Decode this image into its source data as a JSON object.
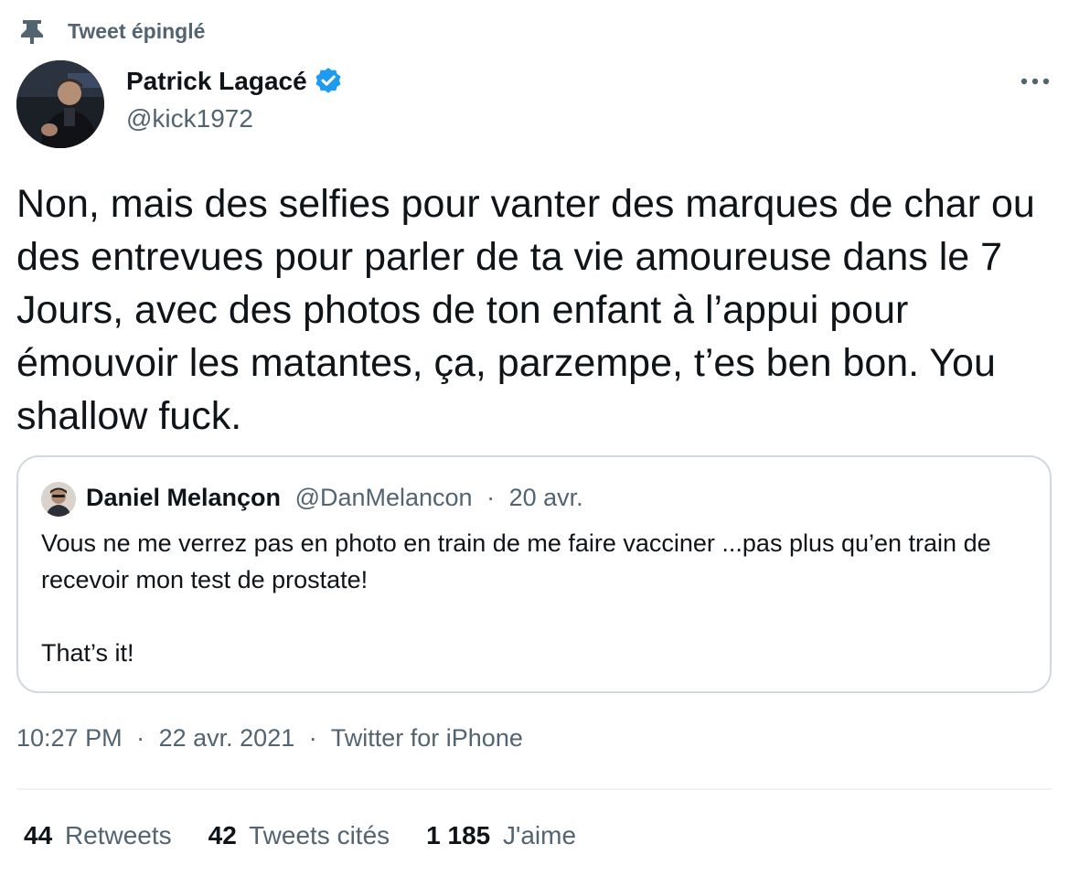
{
  "pinned": {
    "label": "Tweet épinglé",
    "icon": "pin-icon"
  },
  "author": {
    "name": "Patrick Lagacé",
    "handle": "@kick1972",
    "verified": true,
    "verified_color": "#1d9bf0"
  },
  "tweet": {
    "text": "Non, mais des selfies pour vanter des marques de char ou des entrevues pour parler de ta vie amoureuse dans le 7 Jours, avec des photos de ton enfant à l’appui pour émouvoir les matantes, ça, parzempe, t’es ben bon. You shallow fuck."
  },
  "quote": {
    "name": "Daniel Melançon",
    "handle": "@DanMelancon",
    "separator": "·",
    "date": "20 avr.",
    "paragraph1": "Vous ne me verrez pas en photo en train de me faire vacciner ...pas plus qu’en train de recevoir mon test de prostate!",
    "paragraph2": "That’s it!"
  },
  "meta": {
    "time": "10:27 PM",
    "separator": "·",
    "date": "22 avr. 2021",
    "source": "Twitter for iPhone"
  },
  "stats": [
    {
      "count": "44",
      "label": "Retweets"
    },
    {
      "count": "42",
      "label": "Tweets cités"
    },
    {
      "count": "1 185",
      "label": "J'aime"
    }
  ],
  "colors": {
    "text_primary": "#0f1419",
    "text_secondary": "#536471",
    "border": "#cfd9de"
  }
}
